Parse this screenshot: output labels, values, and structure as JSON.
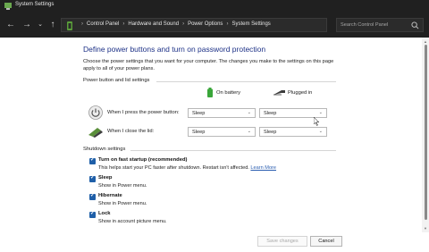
{
  "window": {
    "title": "System Settings"
  },
  "navigation": {
    "breadcrumb": [
      "Control Panel",
      "Hardware and Sound",
      "Power Options",
      "System Settings"
    ],
    "search_placeholder": "Search Control Panel"
  },
  "page": {
    "heading": "Define power buttons and turn on password protection",
    "description": "Choose the power settings that you want for your computer. The changes you make to the settings on this page apply to all of your power plans."
  },
  "power_section": {
    "title": "Power button and lid settings",
    "col_battery": "On battery",
    "col_plugged": "Plugged in",
    "rows": [
      {
        "label": "When I press the power button:",
        "battery": "Sleep",
        "plugged": "Sleep"
      },
      {
        "label": "When I close the lid:",
        "battery": "Sleep",
        "plugged": "Sleep"
      }
    ]
  },
  "shutdown_section": {
    "title": "Shutdown settings",
    "options": [
      {
        "label": "Turn on fast startup (recommended)",
        "desc": "This helps start your PC faster after shutdown. Restart isn't affected.",
        "link": "Learn More",
        "checked": true
      },
      {
        "label": "Sleep",
        "desc": "Show in Power menu.",
        "checked": true
      },
      {
        "label": "Hibernate",
        "desc": "Show in Power menu.",
        "checked": true
      },
      {
        "label": "Lock",
        "desc": "Show in account picture menu.",
        "checked": true
      }
    ]
  },
  "footer": {
    "save_label": "Save changes",
    "cancel_label": "Cancel"
  },
  "colors": {
    "heading": "#1e3287",
    "titlebar": "#202020",
    "checkbox": "#1f5fa8",
    "battery_green": "#3aa63a"
  }
}
